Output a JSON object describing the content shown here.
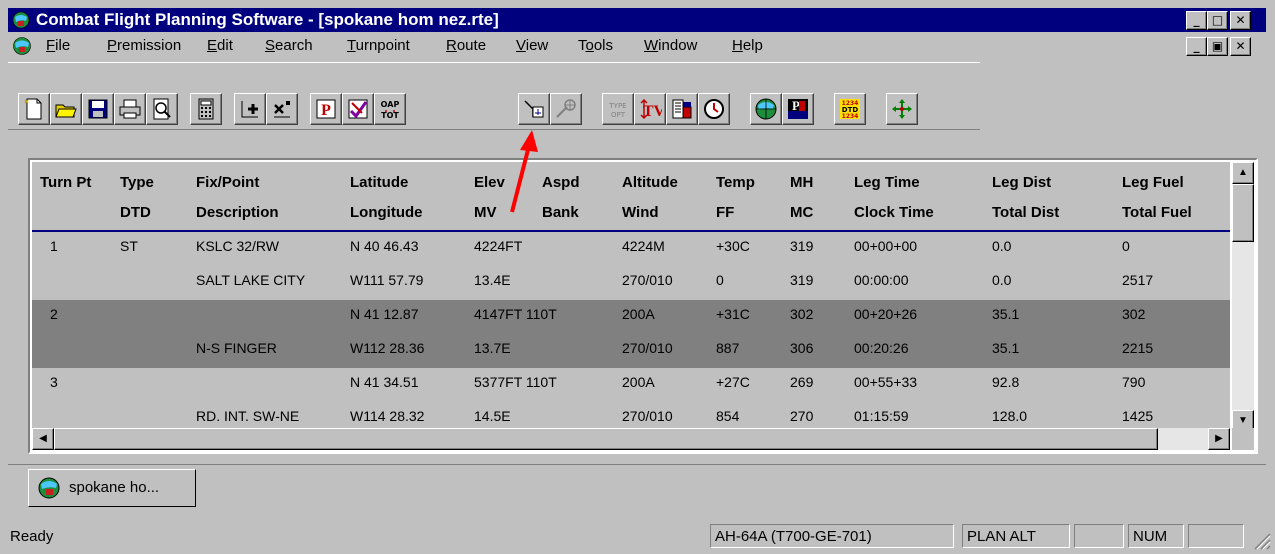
{
  "window": {
    "title": "Combat Flight Planning Software - [spokane hom nez.rte]"
  },
  "caption_buttons": {
    "minimize": "_",
    "maximize": "□",
    "close": "✕"
  },
  "mdi_buttons": {
    "minimize": "_",
    "restore": "▣",
    "close": "✕"
  },
  "menu": [
    {
      "label": "File",
      "accel": "F",
      "rest": "ile"
    },
    {
      "label": "Premission",
      "accel": "P",
      "rest": "remission"
    },
    {
      "label": "Edit",
      "accel": "E",
      "rest": "dit"
    },
    {
      "label": "Search",
      "accel": "S",
      "rest": "earch"
    },
    {
      "label": "Turnpoint",
      "accel": "T",
      "rest": "urnpoint"
    },
    {
      "label": "Route",
      "accel": "R",
      "rest": "oute"
    },
    {
      "label": "View",
      "accel": "V",
      "rest": "iew"
    },
    {
      "label": "Tools",
      "pre": "T",
      "accel": "o",
      "rest": "ols"
    },
    {
      "label": "Window",
      "accel": "W",
      "rest": "indow"
    },
    {
      "label": "Help",
      "accel": "H",
      "rest": "elp"
    }
  ],
  "toolbar": {
    "buttons": [
      {
        "name": "new-icon"
      },
      {
        "name": "open-icon"
      },
      {
        "name": "save-icon"
      },
      {
        "name": "print-icon"
      },
      {
        "name": "print-preview-icon"
      },
      {
        "name": "calculator-icon"
      },
      {
        "name": "insert-turnpoint-icon"
      },
      {
        "name": "delete-turnpoint-icon"
      },
      {
        "name": "p-icon"
      },
      {
        "name": "check-icon"
      },
      {
        "name": "oap-tot-icon"
      },
      {
        "name": "dtd-route-icon"
      },
      {
        "name": "disabled-route-icon"
      },
      {
        "name": "type-opt-icon"
      },
      {
        "name": "tv-icon"
      },
      {
        "name": "fuel-icon"
      },
      {
        "name": "clock-icon"
      },
      {
        "name": "globe-icon"
      },
      {
        "name": "pm-icon"
      },
      {
        "name": "dtd-icon"
      },
      {
        "name": "move-icon"
      }
    ],
    "labels": {
      "oap": "OAP",
      "tot": "TOT",
      "type": "TYPE",
      "opt": "OPT",
      "tv": "TV",
      "p": "P",
      "dtd": "DTD",
      "num": "1234"
    }
  },
  "grid": {
    "headers_row1": [
      "Turn Pt",
      "Type",
      "Fix/Point",
      "Latitude",
      "Elev",
      "Aspd",
      "Altitude",
      "Temp",
      "MH",
      "Leg Time",
      "Leg Dist",
      "Leg Fuel"
    ],
    "headers_row2": [
      "",
      "DTD",
      "Description",
      "Longitude",
      "MV",
      "Bank",
      "Wind",
      "FF",
      "MC",
      "Clock Time",
      "Total Dist",
      "Total Fuel"
    ],
    "rows": [
      {
        "style": "light",
        "a": [
          "1",
          "ST",
          "KSLC 32/RW",
          "N 40 46.43",
          "4224FT",
          "",
          "4224M",
          "+30C",
          "319",
          "00+00+00",
          "0.0",
          "0"
        ],
        "b": [
          "",
          "",
          "SALT LAKE CITY",
          "W111 57.79",
          "13.4E",
          "",
          "270/010",
          "0",
          "319",
          "00:00:00",
          "0.0",
          "2517"
        ]
      },
      {
        "style": "dark",
        "a": [
          "2",
          "",
          "",
          "N 41 12.87",
          "4147FT 110T",
          "",
          "200A",
          "+31C",
          "302",
          "00+20+26",
          "35.1",
          "302"
        ],
        "b": [
          "",
          "",
          "N-S FINGER",
          "W112 28.36",
          "13.7E",
          "",
          "270/010",
          "887",
          "306",
          "00:20:26",
          "35.1",
          "2215"
        ]
      },
      {
        "style": "light",
        "a": [
          "3",
          "",
          "",
          "N 41 34.51",
          "5377FT 110T",
          "",
          "200A",
          "+27C",
          "269",
          "00+55+33",
          "92.8",
          "790"
        ],
        "b": [
          "",
          "",
          "RD. INT. SW-NE",
          "W114 28.32",
          "14.5E",
          "",
          "270/010",
          "854",
          "270",
          "01:15:59",
          "128.0",
          "1425"
        ]
      }
    ]
  },
  "tab": {
    "label": "spokane ho..."
  },
  "status": {
    "ready": "Ready",
    "aircraft": "AH-64A (T700-GE-701)",
    "mode": "PLAN ALT",
    "num": "NUM"
  },
  "colors": {
    "title_bar": "#00007f",
    "face": "#c0c0c0",
    "selected_row": "#808080",
    "annotation_arrow": "#ff0000"
  }
}
